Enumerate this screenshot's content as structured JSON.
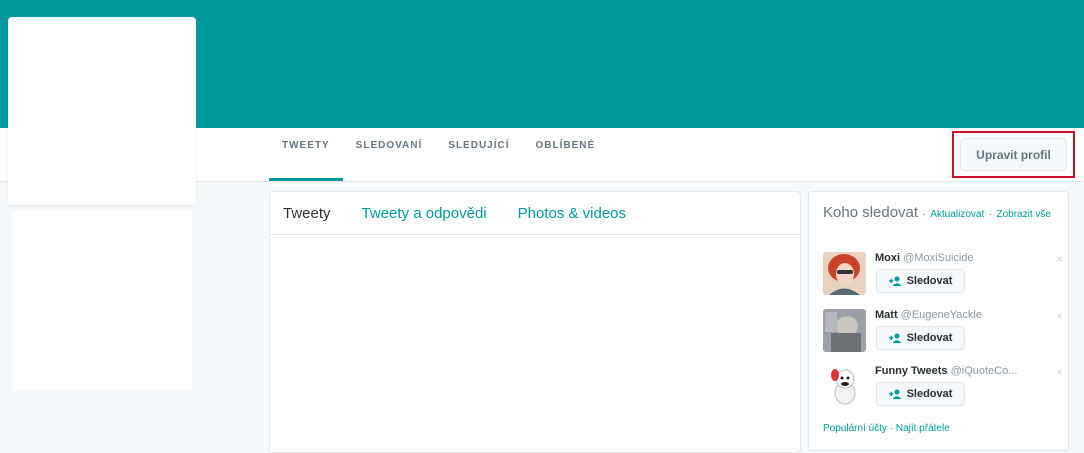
{
  "profile_nav": {
    "tabs": [
      {
        "label": "TWEETY"
      },
      {
        "label": "SLEDOVANÍ"
      },
      {
        "label": "SLEDUJÍCÍ"
      },
      {
        "label": "OBLÍBENÉ"
      }
    ],
    "edit_profile_label": "Upravit profil"
  },
  "timeline": {
    "tabs": [
      {
        "label": "Tweety"
      },
      {
        "label": "Tweety a odpovědi"
      },
      {
        "label": "Photos & videos"
      }
    ]
  },
  "who_to_follow": {
    "title": "Koho sledovat",
    "separator": "·",
    "refresh_label": "Aktualizovat",
    "view_all_label": "Zobrazit vše",
    "close_glyph": "×",
    "follow_label": "Sledovat",
    "suggestions": [
      {
        "name": "Moxi",
        "handle": "@MoxiSuicide"
      },
      {
        "name": "Matt",
        "handle": "@EugeneYackle"
      },
      {
        "name": "Funny Tweets",
        "handle": "@iQuoteCo..."
      }
    ],
    "footer": {
      "popular_label": "Populární účty",
      "find_friends_label": "Najít přátele"
    }
  },
  "colors": {
    "brand": "#009999",
    "highlight_border": "#d0112b"
  },
  "icons": {
    "follow": "follow-person-plus-icon",
    "close": "close-icon"
  }
}
